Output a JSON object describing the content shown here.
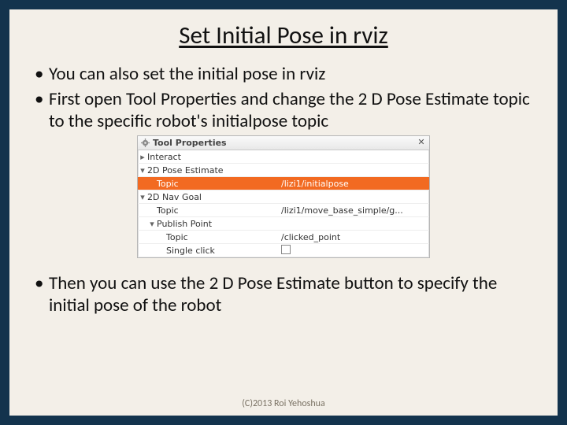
{
  "title": "Set Initial Pose in rviz",
  "bullets": {
    "b1": "You can also set the initial pose in rviz",
    "b2": "First open Tool Properties and change the 2 D Pose Estimate topic to the specific robot's initialpose topic",
    "b3": "Then you can use the 2 D Pose Estimate button to specify the initial pose of the robot"
  },
  "tool_panel": {
    "header": "Tool Properties",
    "rows": {
      "interact": "Interact",
      "pose_estimate": "2D Pose Estimate",
      "pose_topic_label": "Topic",
      "pose_topic_value": "/lizi1/initialpose",
      "nav_goal": "2D Nav Goal",
      "nav_topic_label": "Topic",
      "nav_topic_value": "/lizi1/move_base_simple/g...",
      "publish_point": "Publish Point",
      "pp_topic_label": "Topic",
      "pp_topic_value": "/clicked_point",
      "single_click_label": "Single click"
    }
  },
  "footer": "(C)2013 Roi Yehoshua"
}
